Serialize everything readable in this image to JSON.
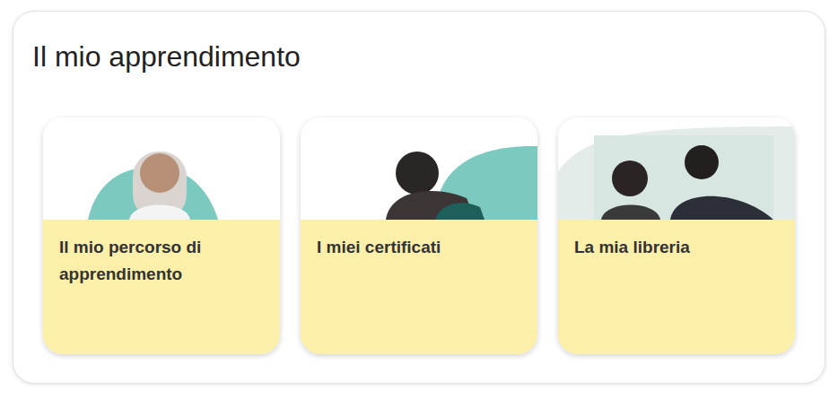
{
  "section": {
    "title": "Il mio apprendimento"
  },
  "cards": [
    {
      "label": "Il mio percorso di apprendimento"
    },
    {
      "label": "I miei certificati"
    },
    {
      "label": "La mia libreria"
    }
  ]
}
